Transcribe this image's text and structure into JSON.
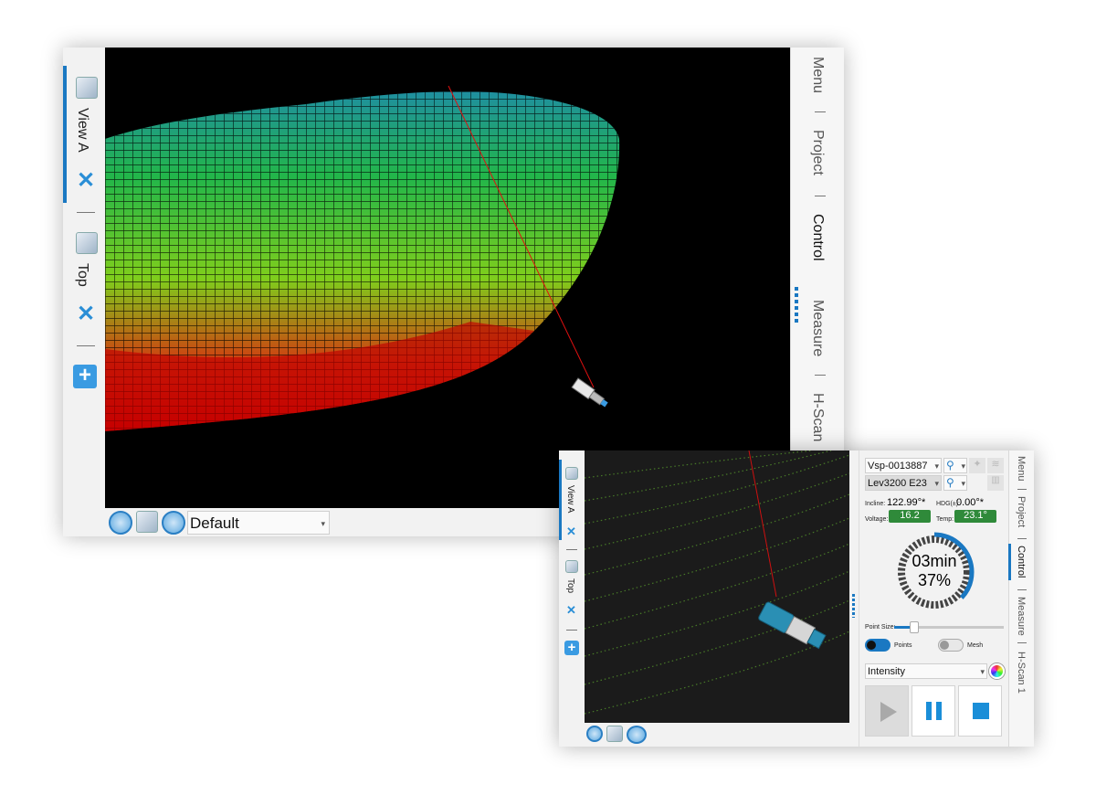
{
  "colors": {
    "accent": "#1a78c2",
    "icon_blue": "#2a8ed6",
    "value_box_green": "#2f8a3a",
    "viewport_black": "#000000"
  },
  "window1": {
    "view_tabs": [
      {
        "label": "View A",
        "icon": "view-cube-icon",
        "active": true
      },
      {
        "label": "Top",
        "icon": "view-cube-icon",
        "active": false
      }
    ],
    "right_tabs": [
      {
        "label": "Menu"
      },
      {
        "label": "Project"
      },
      {
        "label": "Control",
        "active": true
      },
      {
        "label": "Measure"
      },
      {
        "label": "H-Scan"
      }
    ],
    "bottom": {
      "view_preset": "Default"
    }
  },
  "window2": {
    "view_tabs": [
      {
        "label": "View A",
        "active": true
      },
      {
        "label": "Top",
        "active": false
      }
    ],
    "right_tabs": [
      {
        "label": "Menu"
      },
      {
        "label": "Project"
      },
      {
        "label": "Control",
        "active": true
      },
      {
        "label": "Measure"
      },
      {
        "label": "H-Scan 1"
      }
    ],
    "control": {
      "device_serial": "Vsp-0013887",
      "device_model": "Lev3200 E23",
      "incline_label": "Incline:",
      "incline_value": "122.99°*",
      "hdg_label": "HDG(±):",
      "hdg_value": "0.00°*",
      "voltage_label": "Voltage:",
      "voltage_value": "16.2",
      "temp_label": "Temp:",
      "temp_value": "23.1°",
      "progress_time": "03min",
      "progress_percent_label": "37%",
      "progress_fraction": 0.37,
      "point_size_label": "Point Size:",
      "point_size_fraction": 0.18,
      "points_label": "Points",
      "points_on": true,
      "mesh_label": "Mesh",
      "mesh_on": false,
      "color_mode": "Intensity"
    }
  }
}
